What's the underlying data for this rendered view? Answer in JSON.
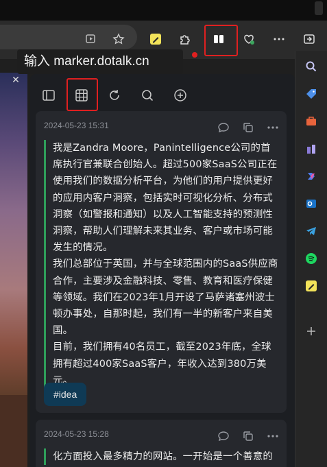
{
  "tooltip": {
    "text": "输入 marker.dotalk.cn"
  },
  "cards": [
    {
      "date": "2024-05-23 15:31",
      "paragraphs": [
        "我是Zandra Moore，Panintelligence公司的首席执行官兼联合创始人。超过500家SaaS公司正在使用我们的数据分析平台，为他们的用户提供更好的应用内客户洞察，包括实时可视化分析、分布式洞察（如警报和通知）以及人工智能支持的预测性洞察，帮助人们理解未来其业务、客户或市场可能发生的情况。",
        "我们总部位于英国，并与全球范围内的SaaS供应商合作，主要涉及金融科技、零售、教育和医疗保健等领域。我们在2023年1月开设了马萨诸塞州波士顿办事处，自那时起，我们有一半的新客户来自美国。",
        "目前，我们拥有40名员工，截至2023年底，全球拥有超过400家SaaS客户，年收入达到380万美元。"
      ],
      "tag": "#idea"
    },
    {
      "date": "2024-05-23 15:28",
      "paragraphs": [
        "化方面投入最多精力的网站。一开始是一个善意的"
      ]
    }
  ],
  "colors": {
    "accent_green": "#2f9e5a",
    "highlight_red": "#e02020",
    "tag_bg": "#0f3a55"
  }
}
